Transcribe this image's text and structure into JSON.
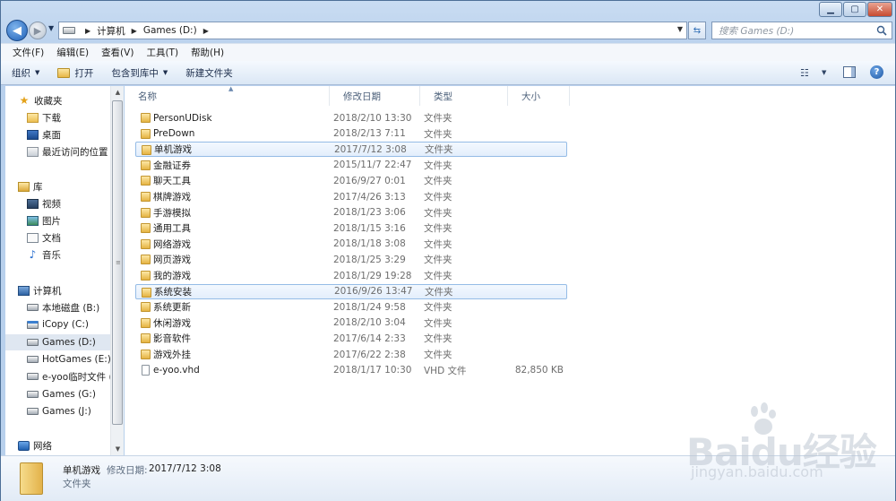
{
  "window": {
    "controls": {
      "minimize": "▁",
      "maximize": "▢",
      "close": "✕"
    }
  },
  "address": {
    "segments": [
      "计算机",
      "Games (D:)"
    ],
    "search_placeholder": "搜索 Games (D:)"
  },
  "menu": [
    "文件(F)",
    "编辑(E)",
    "查看(V)",
    "工具(T)",
    "帮助(H)"
  ],
  "toolbar": {
    "organize": "组织",
    "open": "打开",
    "include_in_library": "包含到库中",
    "new_folder": "新建文件夹"
  },
  "nav": {
    "favorites": "收藏夹",
    "downloads": "下载",
    "desktop": "桌面",
    "recent": "最近访问的位置",
    "libraries": "库",
    "videos": "视频",
    "pictures": "图片",
    "documents": "文档",
    "music": "音乐",
    "computer": "计算机",
    "drive_b": "本地磁盘 (B:)",
    "drive_c": "iCopy (C:)",
    "drive_d": "Games (D:)",
    "drive_e": "HotGames (E:)",
    "drive_f": "e-yoo临时文件 (",
    "drive_g": "Games (G:)",
    "drive_j": "Games (J:)",
    "network": "网络"
  },
  "columns": {
    "name": "名称",
    "date": "修改日期",
    "type": "类型",
    "size": "大小"
  },
  "files": [
    {
      "name": "PersonUDisk",
      "date": "2018/2/10 13:30",
      "type": "文件夹",
      "size": ""
    },
    {
      "name": "PreDown",
      "date": "2018/2/13 7:11",
      "type": "文件夹",
      "size": ""
    },
    {
      "name": "单机游戏",
      "date": "2017/7/12 3:08",
      "type": "文件夹",
      "size": ""
    },
    {
      "name": "金融证券",
      "date": "2015/11/7 22:47",
      "type": "文件夹",
      "size": ""
    },
    {
      "name": "聊天工具",
      "date": "2016/9/27 0:01",
      "type": "文件夹",
      "size": ""
    },
    {
      "name": "棋牌游戏",
      "date": "2017/4/26 3:13",
      "type": "文件夹",
      "size": ""
    },
    {
      "name": "手游模拟",
      "date": "2018/1/23 3:06",
      "type": "文件夹",
      "size": ""
    },
    {
      "name": "通用工具",
      "date": "2018/1/15 3:16",
      "type": "文件夹",
      "size": ""
    },
    {
      "name": "网络游戏",
      "date": "2018/1/18 3:08",
      "type": "文件夹",
      "size": ""
    },
    {
      "name": "网页游戏",
      "date": "2018/1/25 3:29",
      "type": "文件夹",
      "size": ""
    },
    {
      "name": "我的游戏",
      "date": "2018/1/29 19:28",
      "type": "文件夹",
      "size": ""
    },
    {
      "name": "系统安装",
      "date": "2016/9/26 13:47",
      "type": "文件夹",
      "size": ""
    },
    {
      "name": "系统更新",
      "date": "2018/1/24 9:58",
      "type": "文件夹",
      "size": ""
    },
    {
      "name": "休闲游戏",
      "date": "2018/2/10 3:04",
      "type": "文件夹",
      "size": ""
    },
    {
      "name": "影音软件",
      "date": "2017/6/14 2:33",
      "type": "文件夹",
      "size": ""
    },
    {
      "name": "游戏外挂",
      "date": "2017/6/22 2:38",
      "type": "文件夹",
      "size": ""
    },
    {
      "name": "e-yoo.vhd",
      "date": "2018/1/17 10:30",
      "type": "VHD 文件",
      "size": "82,850 KB"
    }
  ],
  "details": {
    "name": "单机游戏",
    "date_label": "修改日期:",
    "date": "2017/7/12 3:08",
    "type": "文件夹"
  },
  "watermark": {
    "logo": "Baidu经验",
    "url": "jingyan.baidu.com"
  }
}
